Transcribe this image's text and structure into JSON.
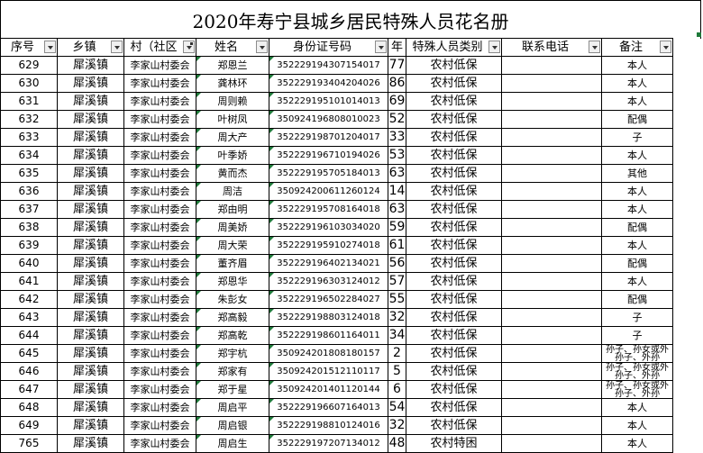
{
  "title": "2020年寿宁县城乡居民特殊人员花名册",
  "columns": [
    "序号",
    "乡镇",
    "村（社区",
    "姓名",
    "身份证号码",
    "年",
    "特殊人员类别",
    "联系电话",
    "备注"
  ],
  "rows": [
    {
      "seq": "629",
      "town": "犀溪镇",
      "village": "李家山村委会",
      "name": "郑恩兰",
      "id": "352229194307154017",
      "age": "77",
      "type": "农村低保",
      "phone": "",
      "note": "本人"
    },
    {
      "seq": "630",
      "town": "犀溪镇",
      "village": "李家山村委会",
      "name": "龚林环",
      "id": "352229193404204026",
      "age": "86",
      "type": "农村低保",
      "phone": "",
      "note": "本人"
    },
    {
      "seq": "631",
      "town": "犀溪镇",
      "village": "李家山村委会",
      "name": "周则赖",
      "id": "352229195101014013",
      "age": "69",
      "type": "农村低保",
      "phone": "",
      "note": "本人"
    },
    {
      "seq": "632",
      "town": "犀溪镇",
      "village": "李家山村委会",
      "name": "叶树凤",
      "id": "350924196808010023",
      "age": "52",
      "type": "农村低保",
      "phone": "",
      "note": "配偶"
    },
    {
      "seq": "633",
      "town": "犀溪镇",
      "village": "李家山村委会",
      "name": "周大产",
      "id": "352229198701204017",
      "age": "33",
      "type": "农村低保",
      "phone": "",
      "note": "子"
    },
    {
      "seq": "634",
      "town": "犀溪镇",
      "village": "李家山村委会",
      "name": "叶季娇",
      "id": "352229196710194026",
      "age": "53",
      "type": "农村低保",
      "phone": "",
      "note": "本人"
    },
    {
      "seq": "635",
      "town": "犀溪镇",
      "village": "李家山村委会",
      "name": "黄而杰",
      "id": "352229195705184013",
      "age": "63",
      "type": "农村低保",
      "phone": "",
      "note": "其他"
    },
    {
      "seq": "636",
      "town": "犀溪镇",
      "village": "李家山村委会",
      "name": "周洁",
      "id": "350924200611260124",
      "age": "14",
      "type": "农村低保",
      "phone": "",
      "note": "本人"
    },
    {
      "seq": "637",
      "town": "犀溪镇",
      "village": "李家山村委会",
      "name": "郑由明",
      "id": "352229195708164018",
      "age": "63",
      "type": "农村低保",
      "phone": "",
      "note": "本人"
    },
    {
      "seq": "638",
      "town": "犀溪镇",
      "village": "李家山村委会",
      "name": "周美娇",
      "id": "352229196103034020",
      "age": "59",
      "type": "农村低保",
      "phone": "",
      "note": "配偶"
    },
    {
      "seq": "639",
      "town": "犀溪镇",
      "village": "李家山村委会",
      "name": "周大荣",
      "id": "352229195910274018",
      "age": "61",
      "type": "农村低保",
      "phone": "",
      "note": "本人"
    },
    {
      "seq": "640",
      "town": "犀溪镇",
      "village": "李家山村委会",
      "name": "董齐眉",
      "id": "352229196402134021",
      "age": "56",
      "type": "农村低保",
      "phone": "",
      "note": "配偶"
    },
    {
      "seq": "641",
      "town": "犀溪镇",
      "village": "李家山村委会",
      "name": "郑恩华",
      "id": "352229196303124012",
      "age": "57",
      "type": "农村低保",
      "phone": "",
      "note": "本人"
    },
    {
      "seq": "642",
      "town": "犀溪镇",
      "village": "李家山村委会",
      "name": "朱彭女",
      "id": "352229196502284027",
      "age": "55",
      "type": "农村低保",
      "phone": "",
      "note": "配偶"
    },
    {
      "seq": "643",
      "town": "犀溪镇",
      "village": "李家山村委会",
      "name": "郑高毅",
      "id": "352229198803124018",
      "age": "32",
      "type": "农村低保",
      "phone": "",
      "note": "子"
    },
    {
      "seq": "644",
      "town": "犀溪镇",
      "village": "李家山村委会",
      "name": "郑高乾",
      "id": "352229198601164011",
      "age": "34",
      "type": "农村低保",
      "phone": "",
      "note": "子"
    },
    {
      "seq": "645",
      "town": "犀溪镇",
      "village": "李家山村委会",
      "name": "郑宇杭",
      "id": "350924201808180157",
      "age": "2",
      "type": "农村低保",
      "phone": "",
      "note": "孙子、孙女或外孙子、外孙"
    },
    {
      "seq": "646",
      "town": "犀溪镇",
      "village": "李家山村委会",
      "name": "郑家有",
      "id": "350924201512110117",
      "age": "5",
      "type": "农村低保",
      "phone": "",
      "note": "孙子、孙女或外孙子、外孙"
    },
    {
      "seq": "647",
      "town": "犀溪镇",
      "village": "李家山村委会",
      "name": "郑于星",
      "id": "350924201401120144",
      "age": "6",
      "type": "农村低保",
      "phone": "",
      "note": "孙子、孙女或外孙子、外孙"
    },
    {
      "seq": "648",
      "town": "犀溪镇",
      "village": "李家山村委会",
      "name": "周启平",
      "id": "352229196607164013",
      "age": "54",
      "type": "农村低保",
      "phone": "",
      "note": "本人"
    },
    {
      "seq": "649",
      "town": "犀溪镇",
      "village": "李家山村委会",
      "name": "周启银",
      "id": "352229198810124016",
      "age": "32",
      "type": "农村低保",
      "phone": "",
      "note": "本人"
    },
    {
      "seq": "765",
      "town": "犀溪镇",
      "village": "李家山村委会",
      "name": "周启生",
      "id": "352229197207134012",
      "age": "48",
      "type": "农村特困",
      "phone": "",
      "note": "本人"
    }
  ],
  "colors": {
    "grid": "#000000",
    "comment_marker": "#1e7a3a",
    "filter_button": "#f0f0f0"
  }
}
